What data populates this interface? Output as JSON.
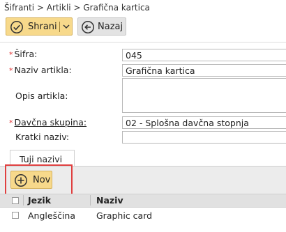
{
  "breadcrumb": {
    "items": [
      "Šifranti",
      "Artikli",
      "Grafična kartica"
    ],
    "separator": ">"
  },
  "toolbar": {
    "save_label": "Shrani",
    "back_label": "Nazaj"
  },
  "form": {
    "sifra": {
      "label": "Šifra:",
      "required": true,
      "value": "045"
    },
    "naziv": {
      "label": "Naziv artikla:",
      "required": true,
      "value": "Grafična kartica"
    },
    "opis": {
      "label": "Opis artikla:",
      "required": false,
      "value": ""
    },
    "davcna": {
      "label": "Davčna skupina:",
      "required": true,
      "value": "02 - Splošna davčna stopnja"
    },
    "kratki": {
      "label": "Kratki naziv:",
      "required": false,
      "value": ""
    },
    "required_marker": "*"
  },
  "tabs": [
    {
      "label": "Tuji nazivi"
    }
  ],
  "tab_toolbar": {
    "new_label": "Nov"
  },
  "table": {
    "columns": [
      "Jezik",
      "Naziv"
    ],
    "rows": [
      {
        "jezik": "Angleščina",
        "naziv": "Graphic card"
      }
    ]
  },
  "colors": {
    "accent_button": "#f7d98b",
    "required": "#e03030",
    "highlight_box": "#e04040"
  },
  "icons": [
    "check-circle-icon",
    "chevron-down-icon",
    "arrow-left-circle-icon",
    "plus-circle-icon",
    "checkbox-icon"
  ]
}
